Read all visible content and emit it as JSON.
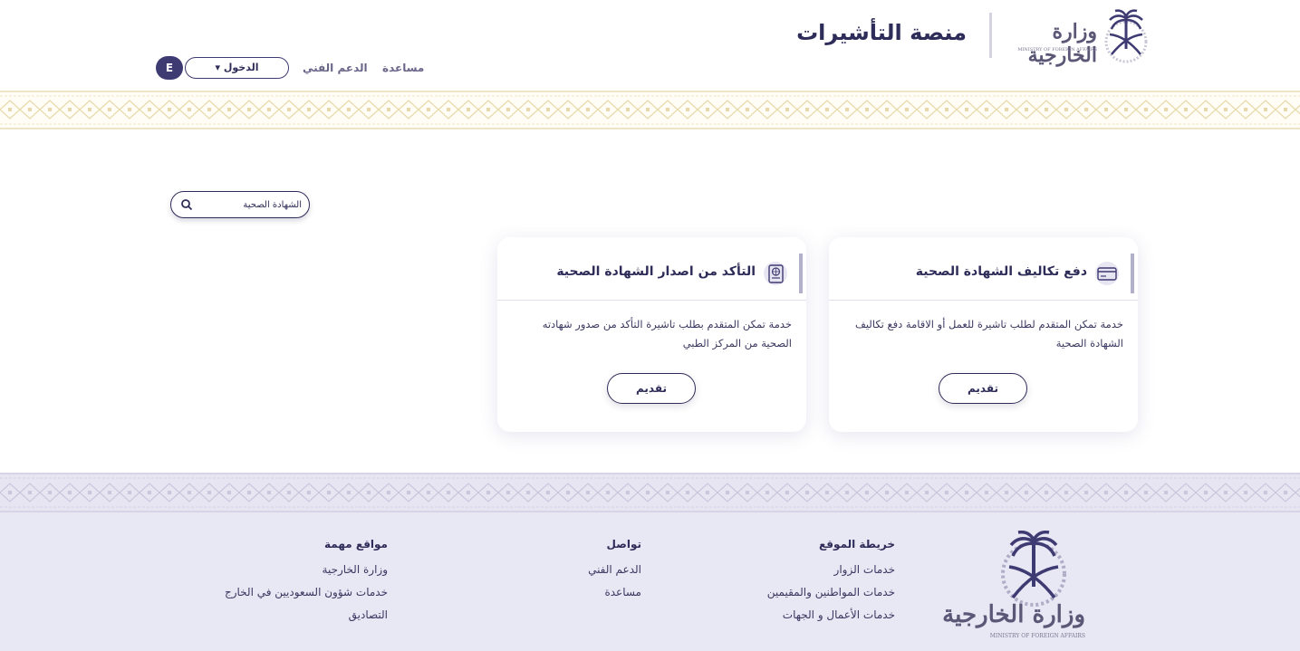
{
  "header": {
    "logo_text": "وزارة الخارجية",
    "logo_subtitle": "MINISTRY OF FOREIGN AFFAIRS",
    "title": "منصة التأشيرات",
    "nav": {
      "help": "مساعدة",
      "support": "الدعم الفني",
      "login": "الدخول ▾",
      "language": "E"
    }
  },
  "search": {
    "value": "الشهادة الصحية",
    "icon": "search-icon"
  },
  "cards": [
    {
      "title": "دفع تكاليف الشهادة الصحية",
      "icon": "credit-card-icon",
      "description": "خدمة تمكن المتقدم لطلب تاشيرة للعمل أو الاقامة دفع تكاليف الشهادة الصحية",
      "button": "تقديم"
    },
    {
      "title": "التأكد من اصدار الشهادة الصحية",
      "icon": "passport-icon",
      "description": "خدمة تمكن المتقدم بطلب تاشيرة التأكد من صدور شهادته الصحية من المركز الطبي",
      "button": "تقديم"
    }
  ],
  "footer": {
    "logo_text": "وزارة الخارجية",
    "logo_subtitle": "MINISTRY OF FOREIGN AFFAIRS",
    "sitemap": {
      "title": "خريطة الموقع",
      "links": [
        "خدمات الزوار",
        "خدمات المواطنين والمقيمين",
        "خدمات الأعمال و الجهات"
      ]
    },
    "contact": {
      "title": "تواصل",
      "links": [
        "الدعم الفني",
        "مساعدة"
      ]
    },
    "important": {
      "title": "مواقع مهمة",
      "links": [
        "وزارة الخارجية",
        "خدمات شؤون السعوديين في الخارج",
        "التصاديق"
      ]
    }
  },
  "colors": {
    "primary": "#2e2c58",
    "accent_bar": "#b3b1c9",
    "footer_bg": "#e8e7f4",
    "band_gold": "#efe5c6"
  }
}
